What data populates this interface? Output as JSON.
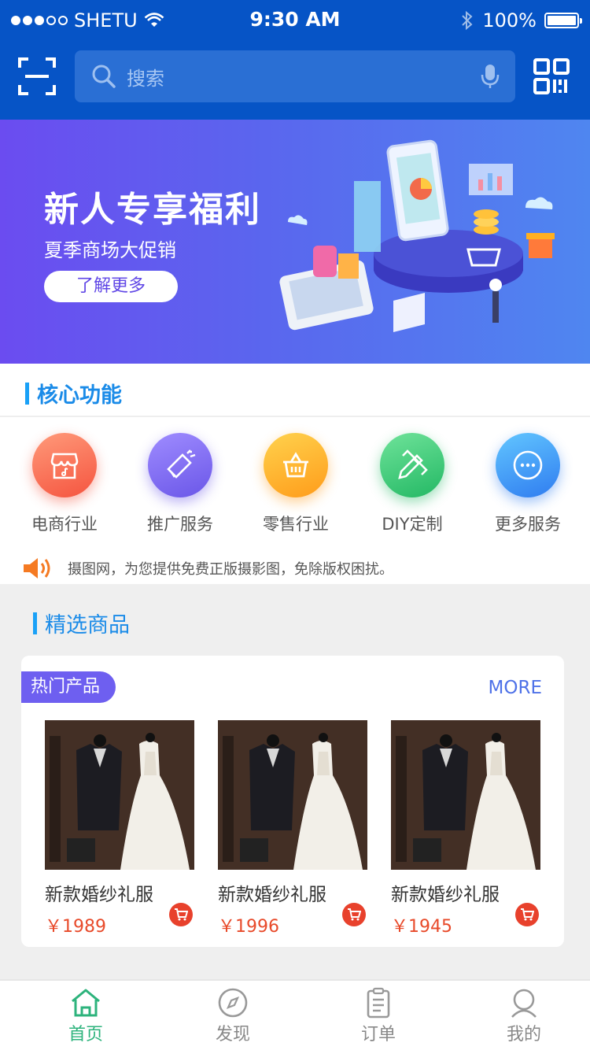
{
  "status_bar": {
    "carrier": "SHETU",
    "time": "9:30 AM",
    "battery": "100%",
    "battery_level": 1.0
  },
  "search": {
    "placeholder": "搜索"
  },
  "header_icons": [
    "scan-icon",
    "search-icon",
    "microphone-icon",
    "qr-code-icon"
  ],
  "banner": {
    "title": "新人专享福利",
    "subtitle": "夏季商场大促销",
    "button": "了解更多"
  },
  "core": {
    "heading": "核心功能",
    "items": [
      {
        "label": "电商行业",
        "icon": "shop-icon",
        "colors": [
          "#ff9a7a",
          "#f5543f"
        ]
      },
      {
        "label": "推广服务",
        "icon": "megaphone-icon",
        "colors": [
          "#9f8cff",
          "#6a56e8"
        ]
      },
      {
        "label": "零售行业",
        "icon": "basket-icon",
        "colors": [
          "#ffd24d",
          "#ff9c1a"
        ]
      },
      {
        "label": "DIY定制",
        "icon": "pencil-ruler-icon",
        "colors": [
          "#6fe39a",
          "#23b864"
        ]
      },
      {
        "label": "更多服务",
        "icon": "more-icon",
        "colors": [
          "#62c6ff",
          "#2f7cf0"
        ]
      }
    ]
  },
  "notice": {
    "text": "摄图网，为您提供免费正版摄影图，免除版权困扰。"
  },
  "featured": {
    "heading": "精选商品",
    "tag": "热门产品",
    "more": "MORE",
    "products": [
      {
        "name": "新款婚纱礼服",
        "price": "￥1989"
      },
      {
        "name": "新款婚纱礼服",
        "price": "￥1996"
      },
      {
        "name": "新款婚纱礼服",
        "price": "￥1945"
      }
    ]
  },
  "tabbar": {
    "items": [
      {
        "label": "首页",
        "icon": "home-icon",
        "active": true
      },
      {
        "label": "发现",
        "icon": "compass-icon",
        "active": false
      },
      {
        "label": "订单",
        "icon": "clipboard-icon",
        "active": false
      },
      {
        "label": "我的",
        "icon": "user-icon",
        "active": false
      }
    ]
  },
  "colors": {
    "header": "#0654c6",
    "accent_blue": "#1a8be8",
    "price": "#e84a2a",
    "tab_active": "#2db37c"
  }
}
